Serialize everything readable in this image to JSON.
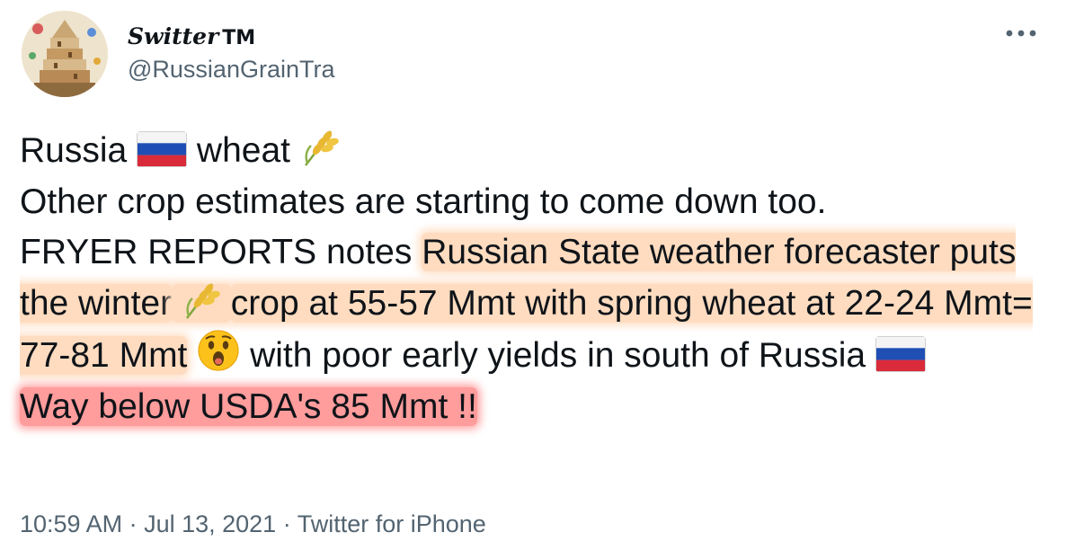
{
  "author": {
    "display_name": "Switter",
    "display_name_suffix": "TM",
    "handle": "@RussianGrainTra"
  },
  "tweet": {
    "line1_a": "Russia",
    "line1_b": "wheat",
    "line2": "Other crop estimates are starting to come down too.",
    "line3_a": "FRYER REPORTS notes ",
    "hl1_a": "Russian State weather forecaster puts the winter",
    "hl1_b": "crop at 55-57 Mmt with spring wheat at 22-24 Mmt= 77-81 Mmt",
    "line5_rest": " with poor early yields in south of Russia",
    "hl2": "Way below USDA's 85 Mmt !!",
    "icons": [
      "russia-flag-icon",
      "wheat-icon",
      "astonished-face-icon"
    ]
  },
  "meta": {
    "time": "10:59 AM",
    "date": "Jul 13, 2021",
    "separator": " · ",
    "source": "Twitter for iPhone"
  },
  "colors": {
    "highlight_orange": "#ffdcc0",
    "highlight_red": "#ff9c9c",
    "secondary_text": "#536471"
  }
}
